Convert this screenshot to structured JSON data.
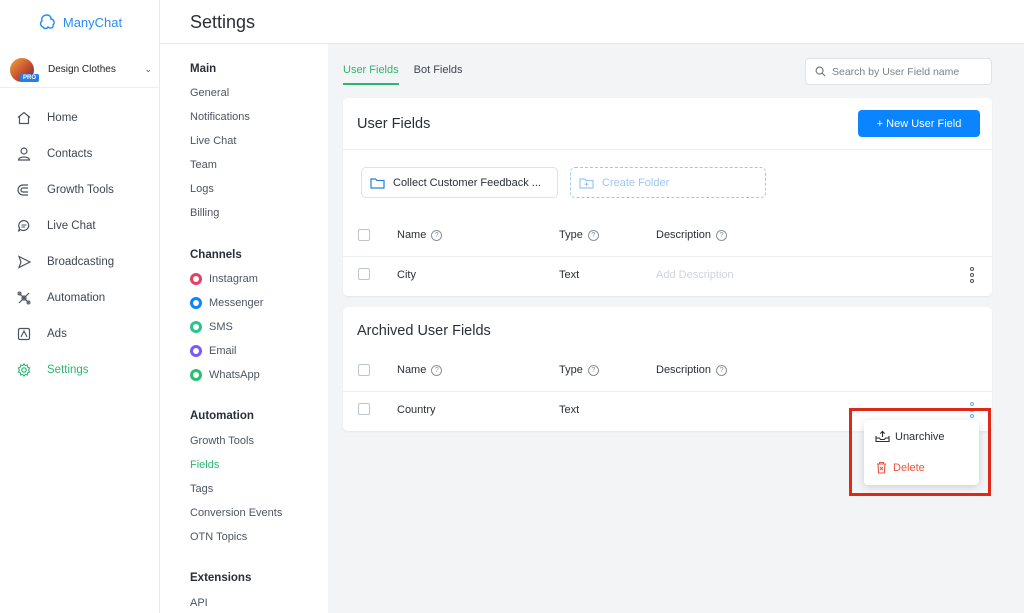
{
  "app": {
    "name": "ManyChat"
  },
  "account": {
    "name": "Design Clothes",
    "badge": "PRO"
  },
  "nav": {
    "items": [
      {
        "label": "Home",
        "icon": "home-icon"
      },
      {
        "label": "Contacts",
        "icon": "user-icon"
      },
      {
        "label": "Growth Tools",
        "icon": "magnet-icon"
      },
      {
        "label": "Live Chat",
        "icon": "chat-icon"
      },
      {
        "label": "Broadcasting",
        "icon": "send-icon"
      },
      {
        "label": "Automation",
        "icon": "automation-icon"
      },
      {
        "label": "Ads",
        "icon": "ads-icon"
      },
      {
        "label": "Settings",
        "icon": "gear-icon"
      }
    ],
    "active": "Settings"
  },
  "header": {
    "title": "Settings"
  },
  "submenu": {
    "main": {
      "heading": "Main",
      "items": [
        "General",
        "Notifications",
        "Live Chat",
        "Team",
        "Logs",
        "Billing"
      ]
    },
    "channels": {
      "heading": "Channels",
      "items": [
        {
          "label": "Instagram",
          "color": "#e4405f"
        },
        {
          "label": "Messenger",
          "color": "#0a84ff"
        },
        {
          "label": "SMS",
          "color": "#2bc48a"
        },
        {
          "label": "Email",
          "color": "#7a5af8"
        },
        {
          "label": "WhatsApp",
          "color": "#25c16f"
        }
      ]
    },
    "automation": {
      "heading": "Automation",
      "items": [
        "Growth Tools",
        "Fields",
        "Tags",
        "Conversion Events",
        "OTN Topics"
      ],
      "active": "Fields"
    },
    "extensions": {
      "heading": "Extensions",
      "items": [
        "API"
      ]
    }
  },
  "tabs": [
    {
      "label": "User Fields",
      "active": true
    },
    {
      "label": "Bot Fields",
      "active": false
    }
  ],
  "search": {
    "placeholder": "Search by User Field name"
  },
  "user_fields": {
    "title": "User Fields",
    "new_button": "+ New User Field",
    "folders": {
      "existing": "Collect Customer Feedback ...",
      "create": "Create Folder"
    },
    "columns": {
      "name": "Name",
      "type": "Type",
      "description": "Description",
      "help": "?"
    },
    "rows": [
      {
        "name": "City",
        "type": "Text",
        "description_placeholder": "Add Description"
      }
    ]
  },
  "archived_fields": {
    "title": "Archived User Fields",
    "columns": {
      "name": "Name",
      "type": "Type",
      "description": "Description",
      "help": "?"
    },
    "rows": [
      {
        "name": "Country",
        "type": "Text"
      }
    ]
  },
  "menu": {
    "unarchive": "Unarchive",
    "delete": "Delete"
  },
  "colors": {
    "accent_green": "#2bb673",
    "primary_blue": "#0a84ff",
    "danger": "#e8543f",
    "highlight": "#e0281a"
  }
}
